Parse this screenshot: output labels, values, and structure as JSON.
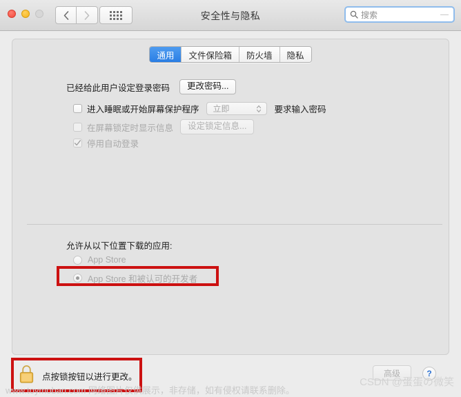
{
  "window": {
    "title": "安全性与隐私",
    "traffic_lights": [
      "close",
      "minimize",
      "zoom"
    ]
  },
  "toolbar": {
    "back_icon": "chevron-left-icon",
    "forward_icon": "chevron-right-icon",
    "showall_icon": "grid-icon"
  },
  "search": {
    "placeholder": "搜索",
    "icon": "search-icon",
    "value": ""
  },
  "tabs": [
    {
      "label": "通用",
      "active": true
    },
    {
      "label": "文件保险箱",
      "active": false
    },
    {
      "label": "防火墙",
      "active": false
    },
    {
      "label": "隐私",
      "active": false
    }
  ],
  "general": {
    "password_status": "已经给此用户设定登录密码",
    "change_password_button": "更改密码...",
    "require_password": {
      "checkbox_label": "进入睡眠或开始屏幕保护程序",
      "checked": false,
      "delay_value": "立即",
      "trailing_label": "要求输入密码"
    },
    "lock_message": {
      "checkbox_label": "在屏幕锁定时显示信息",
      "checked": false,
      "set_button": "设定锁定信息..."
    },
    "disable_auto_login": {
      "checkbox_label": "停用自动登录",
      "checked": true
    }
  },
  "downloads": {
    "title": "允许从以下位置下载的应用:",
    "options": [
      {
        "label": "App Store",
        "selected": false
      },
      {
        "label": "App Store 和被认可的开发者",
        "selected": true
      }
    ]
  },
  "footer": {
    "lock_icon": "padlock-locked-icon",
    "lock_message": "点按锁按钮以进行更改。",
    "advanced_button": "高级",
    "help_button": "?"
  },
  "watermarks": {
    "bottom": "www.toymoban.com 网络图片仅供展示，非存储，如有侵权请联系删除。",
    "csdn": "CSDN @蛋蛋の微笑"
  },
  "colors": {
    "accent_blue": "#2a7ee4",
    "annotation_red": "#cc1111",
    "lock_gold": "#f0b93c"
  }
}
